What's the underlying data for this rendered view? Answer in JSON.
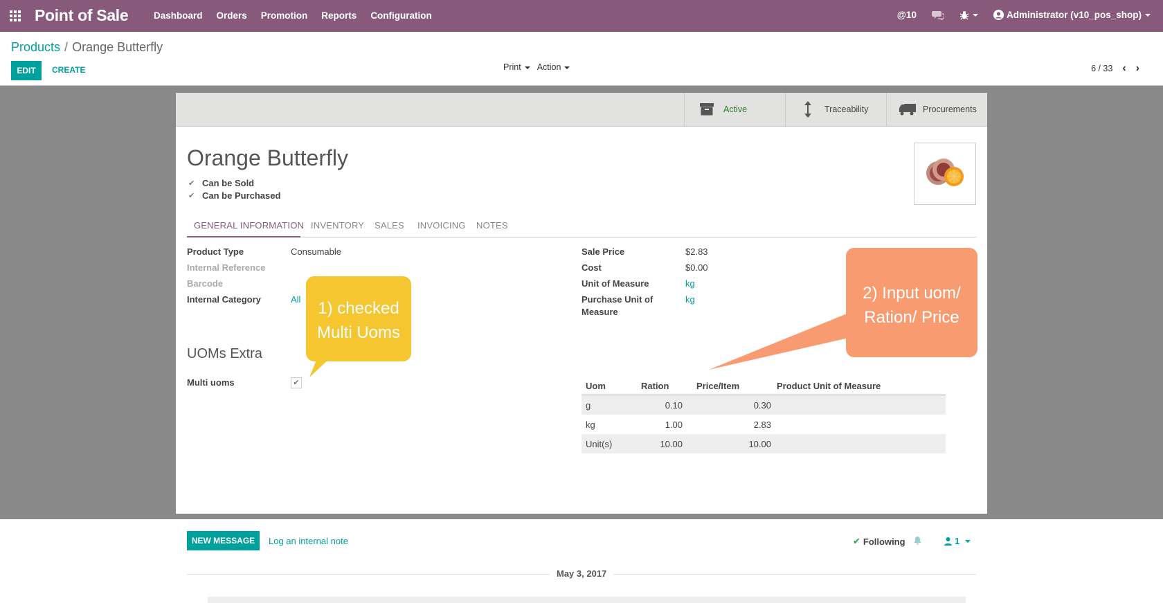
{
  "navbar": {
    "brand": "Point of Sale",
    "menu": [
      "Dashboard",
      "Orders",
      "Promotion",
      "Reports",
      "Configuration"
    ],
    "notifications": "@10",
    "user": "Administrator (v10_pos_shop)"
  },
  "control": {
    "breadcrumb_parent": "Products",
    "breadcrumb_sep": "/",
    "breadcrumb_current": "Orange Butterfly",
    "edit_label": "EDIT",
    "create_label": "CREATE",
    "print_label": "Print",
    "action_label": "Action",
    "pager": "6 / 33"
  },
  "smart_buttons": {
    "active": "Active",
    "traceability": "Traceability",
    "procurements": "Procurements"
  },
  "product": {
    "name": "Orange Butterfly",
    "can_be_sold": "Can be Sold",
    "can_be_purchased": "Can be Purchased"
  },
  "tabs": [
    "GENERAL INFORMATION",
    "INVENTORY",
    "SALES",
    "INVOICING",
    "NOTES"
  ],
  "general": {
    "product_type_label": "Product Type",
    "product_type_value": "Consumable",
    "internal_ref_label": "Internal Reference",
    "barcode_label": "Barcode",
    "internal_category_label": "Internal Category",
    "internal_category_value": "All",
    "sale_price_label": "Sale Price",
    "sale_price_value": "$2.83",
    "cost_label": "Cost",
    "cost_value": "$0.00",
    "uom_label": "Unit of Measure",
    "uom_value": "kg",
    "purchase_uom_label_1": "Purchase Unit of",
    "purchase_uom_label_2": "Measure",
    "purchase_uom_value": "kg"
  },
  "uoms_extra": {
    "title": "UOMs Extra",
    "multi_uoms_label": "Multi uoms"
  },
  "uom_table": {
    "headers": [
      "Uom",
      "Ration",
      "Price/Item",
      "Product Unit of Measure"
    ],
    "rows": [
      {
        "uom": "g",
        "ration": "0.10",
        "price": "0.30"
      },
      {
        "uom": "kg",
        "ration": "1.00",
        "price": "2.83"
      },
      {
        "uom": "Unit(s)",
        "ration": "10.00",
        "price": "10.00"
      }
    ]
  },
  "callouts": {
    "yellow_line1": "1) checked",
    "yellow_line2": "Multi Uoms",
    "orange_line1": "2) Input uom/",
    "orange_line2": "Ration/ Price",
    "yellow_color": "#f6c631",
    "orange_color": "#f89b70"
  },
  "chatter": {
    "new_message": "NEW MESSAGE",
    "log_note": "Log an internal note",
    "following": "Following",
    "followers": "1",
    "date": "May 3, 2017"
  },
  "colors": {
    "brand": "#875a7b",
    "accent": "#00a09d"
  }
}
